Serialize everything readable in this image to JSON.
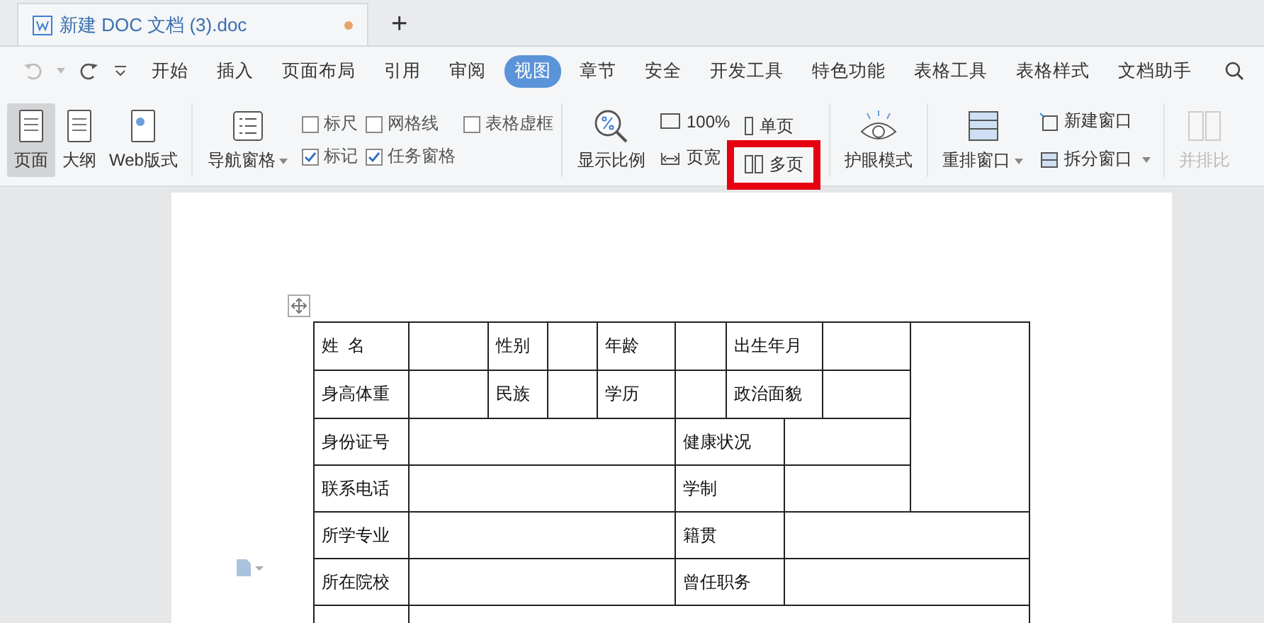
{
  "document_tab": {
    "title": "新建 DOC 文档 (3).doc",
    "modified": true,
    "new_tab": "+"
  },
  "menu": [
    {
      "label": "开始",
      "selected": false
    },
    {
      "label": "插入",
      "selected": false
    },
    {
      "label": "页面布局",
      "selected": false
    },
    {
      "label": "引用",
      "selected": false
    },
    {
      "label": "审阅",
      "selected": false
    },
    {
      "label": "视图",
      "selected": true
    },
    {
      "label": "章节",
      "selected": false
    },
    {
      "label": "安全",
      "selected": false
    },
    {
      "label": "开发工具",
      "selected": false
    },
    {
      "label": "特色功能",
      "selected": false
    },
    {
      "label": "表格工具",
      "selected": false
    },
    {
      "label": "表格样式",
      "selected": false
    },
    {
      "label": "文档助手",
      "selected": false
    }
  ],
  "view_modes": [
    {
      "label": "页面",
      "selected": true
    },
    {
      "label": "大纲",
      "selected": false
    },
    {
      "label": "Web版式",
      "selected": false
    }
  ],
  "nav_pane": {
    "label": "导航窗格"
  },
  "checkboxes": [
    {
      "label": "标尺",
      "checked": false
    },
    {
      "label": "网格线",
      "checked": false
    },
    {
      "label": "表格虚框",
      "checked": false
    },
    {
      "label": "标记",
      "checked": true
    },
    {
      "label": "任务窗格",
      "checked": true
    }
  ],
  "zoom": {
    "label": "显示比例",
    "actual": "100%",
    "page_width": "页宽"
  },
  "pages": [
    {
      "label": "单页",
      "highlighted": false
    },
    {
      "label": "多页",
      "highlighted": true
    }
  ],
  "eye_mode": {
    "label": "护眼模式"
  },
  "windows": {
    "rearrange": "重排窗口",
    "new_window": "新建窗口",
    "split": "拆分窗口",
    "compare": "并排比",
    "compare_disabled": true
  },
  "table": {
    "rows": [
      {
        "kind": "basic",
        "labels": [
          "姓  名",
          "性别",
          "年龄",
          "出生年月"
        ]
      },
      {
        "kind": "basic",
        "labels": [
          "身高体重",
          "民族",
          "学历",
          "政治面貌"
        ]
      },
      {
        "kind": "beside_photo",
        "labels": [
          "身份证号",
          "健康状况"
        ]
      },
      {
        "kind": "beside_photo",
        "labels": [
          "联系电话",
          "学制"
        ]
      },
      {
        "kind": "wide",
        "labels": [
          "所学专业",
          "籍贯"
        ]
      },
      {
        "kind": "wide",
        "labels": [
          "所在院校",
          "曾任职务"
        ]
      },
      {
        "kind": "cut_off"
      }
    ]
  }
}
